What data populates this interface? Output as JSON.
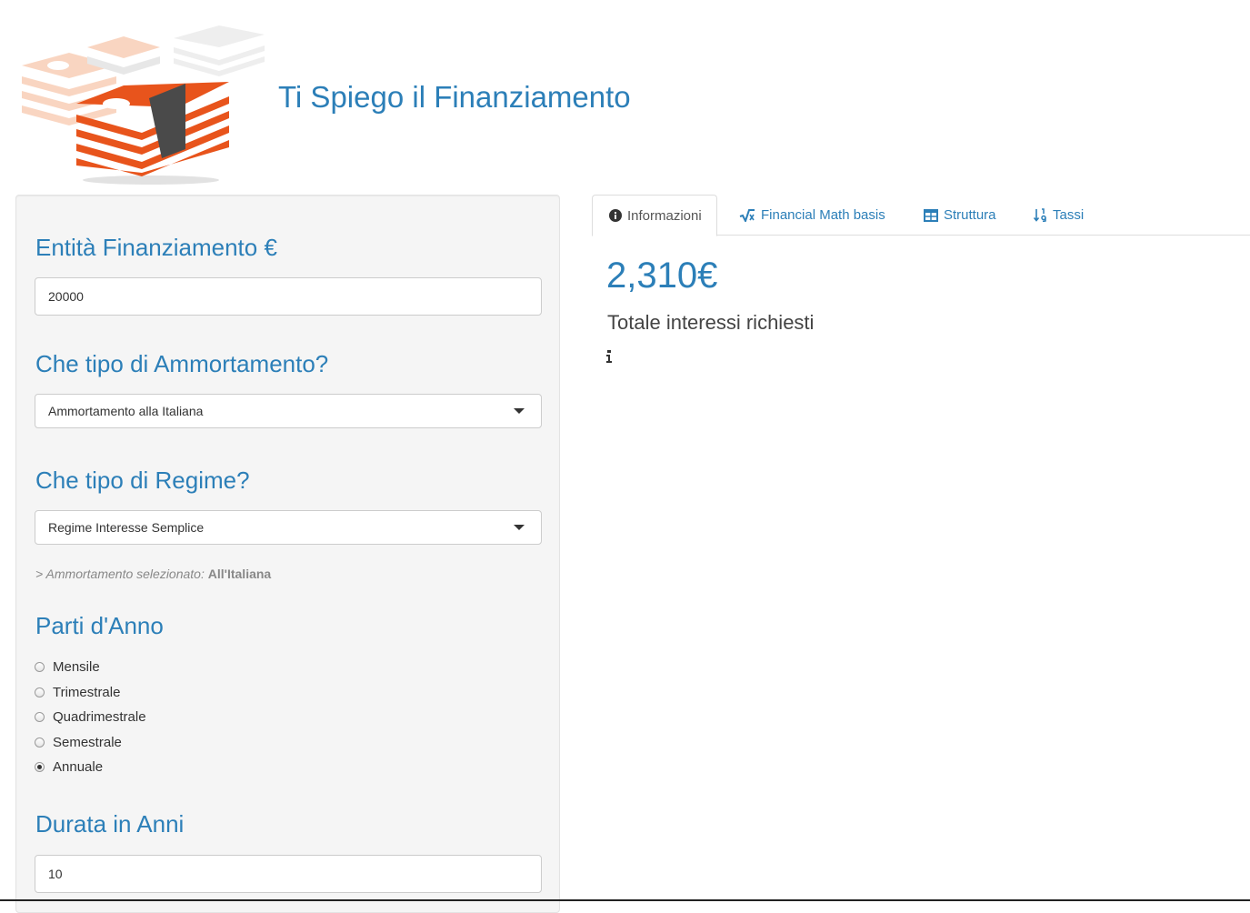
{
  "header": {
    "title": "Ti Spiego il Finanziamento"
  },
  "sidebar": {
    "amount": {
      "label": "Entità Finanziamento €",
      "value": "20000"
    },
    "amortization": {
      "label": "Che tipo di Ammortamento?",
      "selected": "Ammortamento alla Italiana"
    },
    "regime": {
      "label": "Che tipo di Regime?",
      "selected": "Regime Interesse Semplice"
    },
    "note": {
      "prefix": "> Ammortamento selezionato:",
      "value": "All'Italiana"
    },
    "periods": {
      "label": "Parti d'Anno",
      "options": [
        "Mensile",
        "Trimestrale",
        "Quadrimestrale",
        "Semestrale",
        "Annuale"
      ],
      "selected": "Annuale"
    },
    "duration": {
      "label": "Durata in Anni",
      "value": "10"
    }
  },
  "tabs": [
    {
      "label": "Informazioni",
      "icon": "info-circle-icon",
      "active": true
    },
    {
      "label": "Financial Math basis",
      "icon": "square-root-icon",
      "active": false
    },
    {
      "label": "Struttura",
      "icon": "table-icon",
      "active": false
    },
    {
      "label": "Tassi",
      "icon": "sort-numeric-icon",
      "active": false
    }
  ],
  "main": {
    "total_interest": "2,310€",
    "caption": "Totale interessi richiesti",
    "info_icon": "info-icon"
  },
  "colors": {
    "accent": "#2c7fb8",
    "panel": "#f5f5f5",
    "logo_orange": "#e8541c",
    "logo_dark": "#4a4a4a"
  }
}
